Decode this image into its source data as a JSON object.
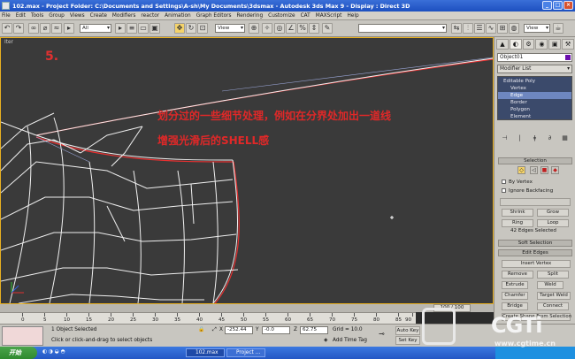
{
  "window": {
    "title": "102.max - Project Folder: C:\\Documents and Settings\\A-sh\\My Documents\\3dsmax - Autodesk 3ds Max 9 - Display : Direct 3D",
    "min": "_",
    "max": "□",
    "close": "×"
  },
  "menu": [
    "File",
    "Edit",
    "Tools",
    "Group",
    "Views",
    "Create",
    "Modifiers",
    "reactor",
    "Animation",
    "Graph Editors",
    "Rendering",
    "Customize",
    "CAT",
    "MAXScript",
    "Help"
  ],
  "toolbar": {
    "selection_filter": "All",
    "ref_coord": "View",
    "named_selection": "",
    "render_view": "View"
  },
  "viewport": {
    "label": "Iter",
    "step": "5.",
    "note_line1": "划分过的一些细节处理，例如在分界处加出一道线",
    "note_line2": "增强光滑后的SHELL感"
  },
  "command_panel": {
    "tabs": [
      "▲",
      "◐",
      "⚙",
      "◉",
      "▣",
      "⚒"
    ],
    "object_name": "Object01",
    "modifier_list": "Modifier List",
    "stack": [
      "Editable Poly",
      "Vertex",
      "Edge",
      "Border",
      "Polygon",
      "Element"
    ],
    "stack_tools": [
      "⊣",
      "|",
      "ǂ",
      "∂",
      "▦"
    ],
    "selection_title": "Selection",
    "by_vertex": "By Vertex",
    "ignore_backfacing": "Ignore Backfacing",
    "shrink": "Shrink",
    "grow": "Grow",
    "ring": "Ring",
    "loop": "Loop",
    "selected_info": "42 Edges Selected",
    "soft_selection": "Soft Selection",
    "edit_edges": "Edit Edges",
    "insert_vertex": "Insert Vertex",
    "remove": "Remove",
    "split": "Split",
    "extrude": "Extrude",
    "weld": "Weld",
    "chamfer": "Chamfer",
    "target_weld": "Target Weld",
    "bridge": "Bridge",
    "connect": "Connect",
    "create_shape": "Create Shape From Selection"
  },
  "timeline": {
    "frame_slider": "100 / 100",
    "ticks": [
      "0",
      "5",
      "10",
      "15",
      "20",
      "25",
      "30",
      "35",
      "40",
      "45",
      "50",
      "55",
      "60",
      "65",
      "70",
      "75",
      "80",
      "85",
      "90"
    ]
  },
  "status": {
    "selected": "1 Object Selected",
    "prompt": "Click or click-and-drag to select objects",
    "x_label": "X",
    "x": "-252.44",
    "y_label": "Y",
    "y": "-0.0",
    "z_label": "Z",
    "z": "62.75",
    "grid": "Grid = 10.0",
    "add_time_tag": "Add Time Tag",
    "auto_key": "Auto Key",
    "set_key": "Set Key"
  },
  "taskbar": {
    "start": "开始",
    "items": [
      "102.max",
      "Project ..."
    ]
  },
  "watermark": {
    "brand": "CGTi",
    "url": "www.cgtime.cn"
  }
}
